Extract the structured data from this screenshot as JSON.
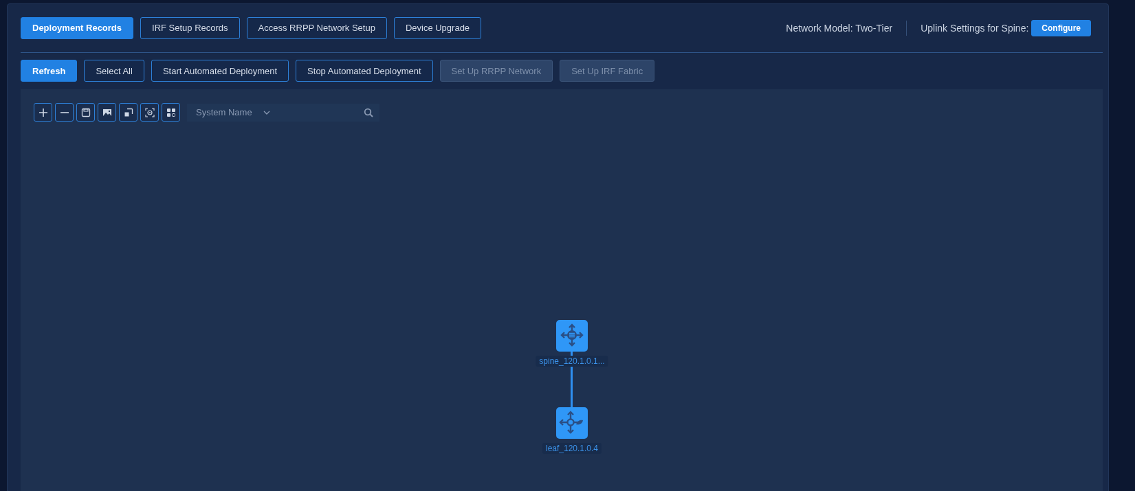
{
  "tabs": [
    {
      "label": "Deployment Records",
      "selected": true
    },
    {
      "label": "IRF Setup Records",
      "selected": false
    },
    {
      "label": "Access RRPP Network Setup",
      "selected": false
    },
    {
      "label": "Device Upgrade",
      "selected": false
    }
  ],
  "network_model": "Network Model: Two-Tier",
  "uplink_settings": {
    "label": "Uplink Settings for Spine:",
    "button": "Configure"
  },
  "actions": [
    {
      "label": "Refresh",
      "kind": "primary",
      "disabled": false
    },
    {
      "label": "Select All",
      "kind": "outline",
      "disabled": false
    },
    {
      "label": "Start Automated Deployment",
      "kind": "outline",
      "disabled": false
    },
    {
      "label": "Stop Automated Deployment",
      "kind": "outline",
      "disabled": false
    },
    {
      "label": "Set Up RRPP Network",
      "kind": "outline",
      "disabled": true
    },
    {
      "label": "Set Up IRF Fabric",
      "kind": "outline",
      "disabled": true
    }
  ],
  "topology_tools": [
    {
      "kind": "zoom-in"
    },
    {
      "kind": "zoom-out"
    },
    {
      "kind": "save"
    },
    {
      "kind": "image"
    },
    {
      "kind": "resize"
    },
    {
      "kind": "focus"
    },
    {
      "kind": "layout"
    }
  ],
  "search": {
    "field": "System Name"
  },
  "nodes": [
    {
      "kind": "spine",
      "label": "spine_120.1.0.1...",
      "children": [
        {
          "kind": "leaf",
          "label": "leaf_120.1.0.4"
        }
      ]
    }
  ]
}
